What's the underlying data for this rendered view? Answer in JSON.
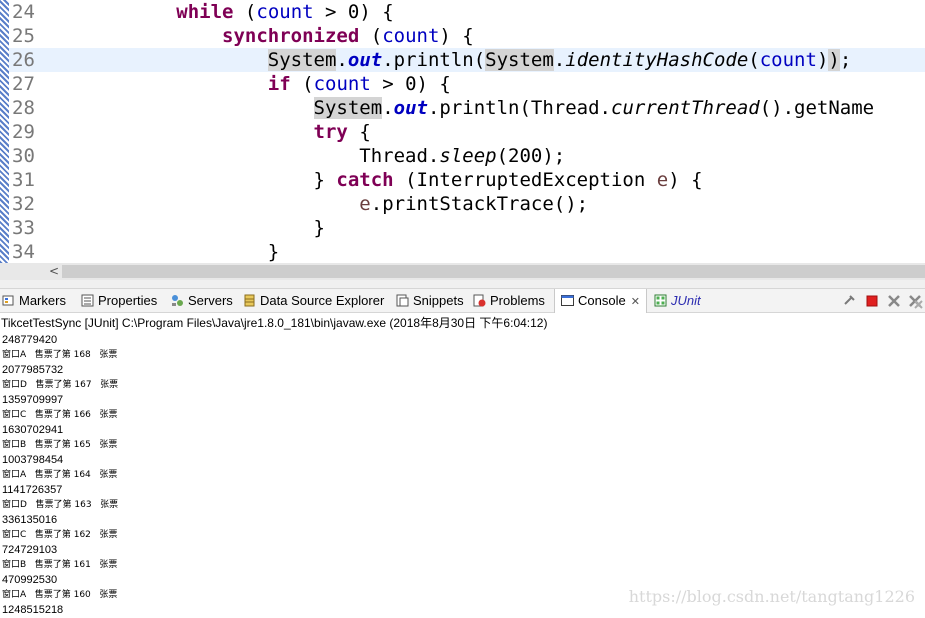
{
  "editor": {
    "lines": [
      {
        "n": "24",
        "html": "            <span class=\"kw\">while</span> (<span class=\"cnt\">count</span> &gt; 0) {"
      },
      {
        "n": "25",
        "html": "                <span class=\"kw\">synchronized</span> (<span class=\"cnt\">count</span>) {"
      },
      {
        "n": "26",
        "html": "                    <span class=\"hl\">System</span>.<span class=\"fld\">out</span>.println(<span class=\"hl\">System</span>.<span class=\"it\">identityHashCode</span>(<span class=\"cnt\">count</span>)<span class=\"hl\">)</span>;"
      },
      {
        "n": "27",
        "html": "                    <span class=\"kw\">if</span> (<span class=\"cnt\">count</span> &gt; 0) {"
      },
      {
        "n": "28",
        "html": "                        <span class=\"hl\">System</span>.<span class=\"fld\">out</span>.println(Thread.<span class=\"it\">currentThread</span>().getName"
      },
      {
        "n": "29",
        "html": "                        <span class=\"kw\">try</span> {"
      },
      {
        "n": "30",
        "html": "                            Thread.<span class=\"it\">sleep</span>(200);"
      },
      {
        "n": "31",
        "html": "                        } <span class=\"kw\">catch</span> (InterruptedException <span class=\"var\">e</span>) {"
      },
      {
        "n": "32",
        "html": "                            <span class=\"var\">e</span>.printStackTrace();"
      },
      {
        "n": "33",
        "html": "                        }"
      },
      {
        "n": "34",
        "html": "                    }"
      }
    ],
    "current_line_index": 2,
    "scroll_left_arrow": "<"
  },
  "tabs": {
    "markers": "Markers",
    "properties": "Properties",
    "servers": "Servers",
    "data_source_explorer": "Data Source Explorer",
    "snippets": "Snippets",
    "problems": "Problems",
    "console": "Console",
    "console_close": "✕",
    "junit": "JUnit"
  },
  "icons": {
    "markers": "markers-icon",
    "properties": "properties-icon",
    "servers": "servers-icon",
    "data_source": "database-icon",
    "snippets": "snippets-icon",
    "problems": "problems-icon",
    "console": "console-icon",
    "junit": "junit-icon",
    "tools": [
      "pin-icon",
      "terminate-icon",
      "remove-launch-icon",
      "remove-all-icon"
    ]
  },
  "colors": {
    "keyword": "#7f0055",
    "field": "#0000c0",
    "current_line": "#e8f2fe",
    "terminate": "#e02020"
  },
  "console": {
    "title": "TikcetTestSync [JUnit] C:\\Program Files\\Java\\jre1.8.0_181\\bin\\javaw.exe (2018年8月30日 下午6:04:12)",
    "output": [
      {
        "t": "num",
        "v": "248779420"
      },
      {
        "t": "msg",
        "v": "窗口A   售票了第 168   张票"
      },
      {
        "t": "num",
        "v": "2077985732"
      },
      {
        "t": "msg",
        "v": "窗口D   售票了第 167   张票"
      },
      {
        "t": "num",
        "v": "1359709997"
      },
      {
        "t": "msg",
        "v": "窗口C   售票了第 166   张票"
      },
      {
        "t": "num",
        "v": "1630702941"
      },
      {
        "t": "msg",
        "v": "窗口B   售票了第 165   张票"
      },
      {
        "t": "num",
        "v": "1003798454"
      },
      {
        "t": "msg",
        "v": "窗口A   售票了第 164   张票"
      },
      {
        "t": "num",
        "v": "1141726357"
      },
      {
        "t": "msg",
        "v": "窗口D   售票了第 163   张票"
      },
      {
        "t": "num",
        "v": "336135016"
      },
      {
        "t": "msg",
        "v": "窗口C   售票了第 162   张票"
      },
      {
        "t": "num",
        "v": "724729103"
      },
      {
        "t": "msg",
        "v": "窗口B   售票了第 161   张票"
      },
      {
        "t": "num",
        "v": "470992530"
      },
      {
        "t": "msg",
        "v": "窗口A   售票了第 160   张票"
      },
      {
        "t": "num",
        "v": "1248515218"
      }
    ]
  },
  "watermark": "https://blog.csdn.net/tangtang1226"
}
